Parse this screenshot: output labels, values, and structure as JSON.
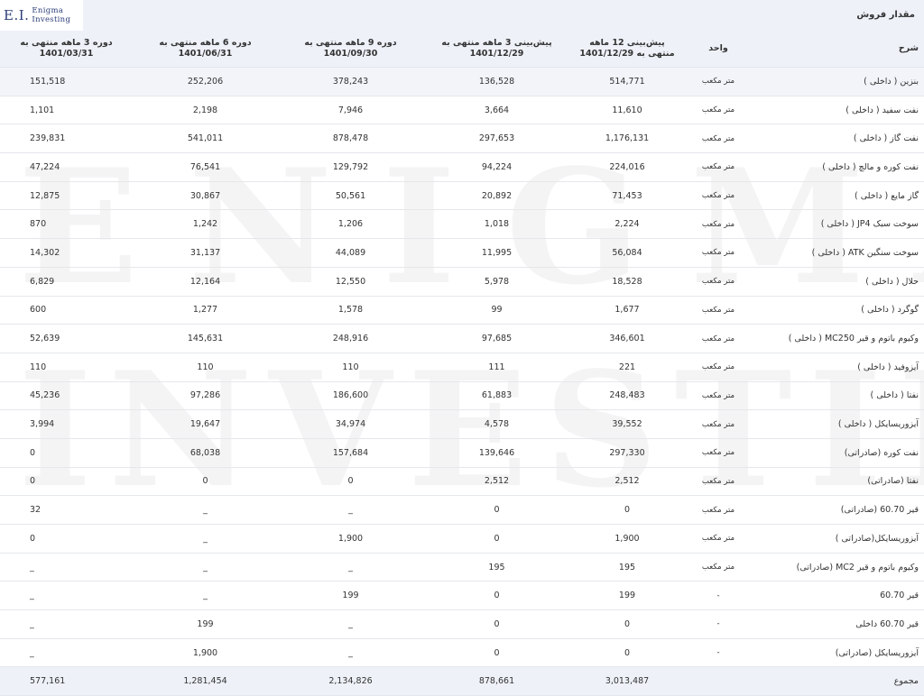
{
  "logo": {
    "mono": "E.I.",
    "line1": "Enigma",
    "line2": "Investing",
    "watermark_line1": "ENIGMA",
    "watermark_line2": "INVESTING"
  },
  "title": "مقدار فروش",
  "headers": {
    "desc": "شرح",
    "unit": "واحد",
    "f12": "پیش‌بینی 12 ماهه منتهی به 1401/12/29",
    "f3": "پیش‌بینی 3 ماهه منتهی به 1401/12/29",
    "p9": "دوره 9 ماهه منتهی به 1401/09/30",
    "p6": "دوره 6 ماهه منتهی به 1401/06/31",
    "p3": "دوره 3 ماهه منتهی به 1401/03/31"
  },
  "rows": [
    {
      "desc": "بنزین ( داخلی )",
      "unit": "متر مکعب",
      "f12": "514,771",
      "f3": "136,528",
      "p9": "378,243",
      "p6": "252,206",
      "p3": "151,518"
    },
    {
      "desc": "نفت سفید ( داخلی )",
      "unit": "متر مکعب",
      "f12": "11,610",
      "f3": "3,664",
      "p9": "7,946",
      "p6": "2,198",
      "p3": "1,101"
    },
    {
      "desc": "نفت گاز ( داخلی )",
      "unit": "متر مکعب",
      "f12": "1,176,131",
      "f3": "297,653",
      "p9": "878,478",
      "p6": "541,011",
      "p3": "239,831"
    },
    {
      "desc": "نفت کوره و مالچ ( داخلی )",
      "unit": "متر مکعب",
      "f12": "224,016",
      "f3": "94,224",
      "p9": "129,792",
      "p6": "76,541",
      "p3": "47,224"
    },
    {
      "desc": "گاز مایع ( داخلی )",
      "unit": "متر مکعب",
      "f12": "71,453",
      "f3": "20,892",
      "p9": "50,561",
      "p6": "30,867",
      "p3": "12,875"
    },
    {
      "desc": "سوخت سبک JP4 ( داخلی )",
      "unit": "متر مکعب",
      "f12": "2,224",
      "f3": "1,018",
      "p9": "1,206",
      "p6": "1,242",
      "p3": "870"
    },
    {
      "desc": "سوخت سنگین ATK ( داخلی )",
      "unit": "متر مکعب",
      "f12": "56,084",
      "f3": "11,995",
      "p9": "44,089",
      "p6": "31,137",
      "p3": "14,302"
    },
    {
      "desc": "حلال ( داخلی )",
      "unit": "متر مکعب",
      "f12": "18,528",
      "f3": "5,978",
      "p9": "12,550",
      "p6": "12,164",
      "p3": "6,829"
    },
    {
      "desc": "گوگرد ( داخلی )",
      "unit": "متر مکعب",
      "f12": "1,677",
      "f3": "99",
      "p9": "1,578",
      "p6": "1,277",
      "p3": "600"
    },
    {
      "desc": "وکیوم باتوم و قیر MC250 ( داخلی )",
      "unit": "متر مکعب",
      "f12": "346,601",
      "f3": "97,685",
      "p9": "248,916",
      "p6": "145,631",
      "p3": "52,639"
    },
    {
      "desc": "آیزوفید ( داخلی )",
      "unit": "متر مکعب",
      "f12": "221",
      "f3": "111",
      "p9": "110",
      "p6": "110",
      "p3": "110"
    },
    {
      "desc": "نفتا ( داخلی )",
      "unit": "متر مکعب",
      "f12": "248,483",
      "f3": "61,883",
      "p9": "186,600",
      "p6": "97,286",
      "p3": "45,236"
    },
    {
      "desc": "آیزوریسایکل ( داخلی )",
      "unit": "متر مکعب",
      "f12": "39,552",
      "f3": "4,578",
      "p9": "34,974",
      "p6": "19,647",
      "p3": "3,994"
    },
    {
      "desc": "نفت کوره (صادراتی)",
      "unit": "متر مکعب",
      "f12": "297,330",
      "f3": "139,646",
      "p9": "157,684",
      "p6": "68,038",
      "p3": "0"
    },
    {
      "desc": "نفتا (صادراتی)",
      "unit": "متر مکعب",
      "f12": "2,512",
      "f3": "2,512",
      "p9": "0",
      "p6": "0",
      "p3": "0"
    },
    {
      "desc": "قیر 60.70 (صادراتی)",
      "unit": "متر مکعب",
      "f12": "0",
      "f3": "0",
      "p9": "_",
      "p6": "_",
      "p3": "32"
    },
    {
      "desc": "آیزوریسایکل(صادراتی )",
      "unit": "متر مکعب",
      "f12": "1,900",
      "f3": "0",
      "p9": "1,900",
      "p6": "_",
      "p3": "0"
    },
    {
      "desc": "وکیوم باتوم و قیر MC2 (صادراتی)",
      "unit": "متر مکعب",
      "f12": "195",
      "f3": "195",
      "p9": "_",
      "p6": "_",
      "p3": "_"
    },
    {
      "desc": "قیر 60.70",
      "unit": "-",
      "f12": "199",
      "f3": "0",
      "p9": "199",
      "p6": "_",
      "p3": "_"
    },
    {
      "desc": "قیر 60.70 داخلی",
      "unit": "-",
      "f12": "0",
      "f3": "0",
      "p9": "_",
      "p6": "199",
      "p3": "_"
    },
    {
      "desc": "آیزوریسایکل (صادراتی)",
      "unit": "-",
      "f12": "0",
      "f3": "0",
      "p9": "_",
      "p6": "1,900",
      "p3": "_"
    }
  ],
  "total": {
    "desc": "مجموع",
    "unit": "",
    "f12": "3,013,487",
    "f3": "878,661",
    "p9": "2,134,826",
    "p6": "1,281,454",
    "p3": "577,161"
  }
}
